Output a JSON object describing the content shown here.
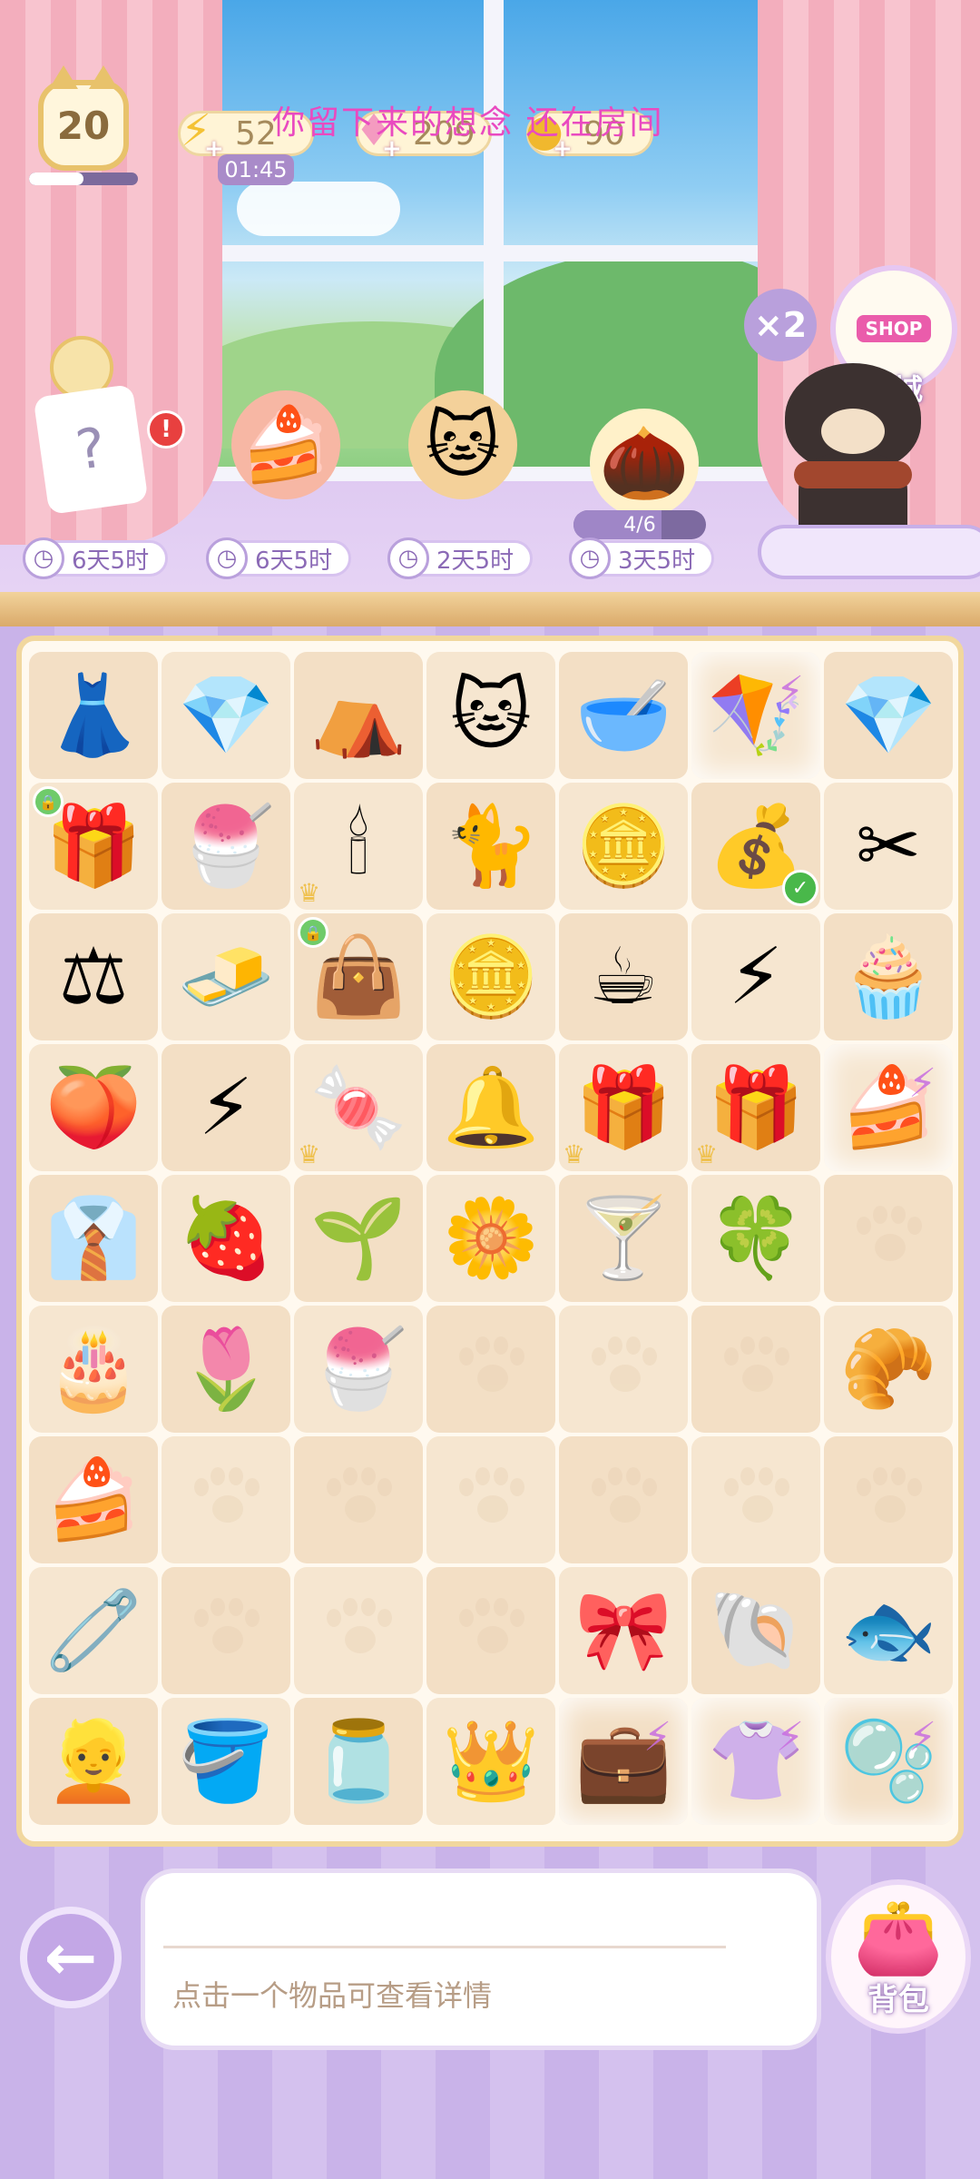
{
  "hud": {
    "level": "20",
    "level_progress": 0.5,
    "energy": "52",
    "energy_timer": "01:45",
    "gems": "209",
    "coins": "90",
    "banner_text": "你留下来的想念 还在房间"
  },
  "shop": {
    "sign": "SHOP",
    "label": "商城",
    "multiplier": "×2"
  },
  "orders": [
    {
      "timer": "6天5时",
      "alert": "!"
    },
    {
      "timer": "6天5时"
    },
    {
      "timer": "2天5时"
    },
    {
      "timer": "3天5时",
      "progress_text": "4/6",
      "progress": 0.6667
    }
  ],
  "board": {
    "rows": [
      [
        {
          "icon": "dress-icon",
          "glyph": "👗"
        },
        {
          "icon": "pink-gems-icon",
          "glyph": "💎"
        },
        {
          "icon": "tent-icon",
          "glyph": "⛺"
        },
        {
          "icon": "brown-cat-icon",
          "glyph": "🐱"
        },
        {
          "icon": "pet-bowl-icon",
          "glyph": "🥣"
        },
        {
          "icon": "swing-energy-icon",
          "glyph": "🪁",
          "bolt": true
        },
        {
          "icon": "pink-gem-icon",
          "glyph": "💎"
        }
      ],
      [
        {
          "icon": "gift-box-icon",
          "glyph": "🎁",
          "lock": true
        },
        {
          "icon": "parfait-icon",
          "glyph": "🍧"
        },
        {
          "icon": "candelabra-icon",
          "glyph": "🕯",
          "crown": true
        },
        {
          "icon": "white-cat-icon",
          "glyph": "🐈"
        },
        {
          "icon": "coin-pile-icon",
          "glyph": "🪙"
        },
        {
          "icon": "coin-sack-icon",
          "glyph": "💰",
          "check": true
        },
        {
          "icon": "pruning-shears-icon",
          "glyph": "✂"
        }
      ],
      [
        {
          "icon": "scale-icon",
          "glyph": "⚖"
        },
        {
          "icon": "butter-cream-icon",
          "glyph": "🧈"
        },
        {
          "icon": "blue-bag-icon",
          "glyph": "👜",
          "lock": true
        },
        {
          "icon": "coins-icon",
          "glyph": "🪙"
        },
        {
          "icon": "coffee-bowl-icon",
          "glyph": "☕"
        },
        {
          "icon": "energy-stack-icon",
          "glyph": "⚡"
        },
        {
          "icon": "cupcake-icon",
          "glyph": "🧁"
        }
      ],
      [
        {
          "icon": "peach-icon",
          "glyph": "🍑"
        },
        {
          "icon": "double-energy-icon",
          "glyph": "⚡"
        },
        {
          "icon": "snack-pack-icon",
          "glyph": "🍬",
          "crown": true
        },
        {
          "icon": "bells-icon",
          "glyph": "🔔"
        },
        {
          "icon": "blue-gift-icon",
          "glyph": "🎁",
          "crown": true
        },
        {
          "icon": "blue-gift-icon",
          "glyph": "🎁",
          "crown": true
        },
        {
          "icon": "dessert-box-icon",
          "glyph": "🍰",
          "bolt": true
        }
      ],
      [
        {
          "icon": "outfit-icon",
          "glyph": "👔"
        },
        {
          "icon": "strawberry-basket-icon",
          "glyph": "🍓"
        },
        {
          "icon": "sprout-icon",
          "glyph": "🌱"
        },
        {
          "icon": "lily-of-valley-icon",
          "glyph": "🌼"
        },
        {
          "icon": "wine-glass-icon",
          "glyph": "🍸"
        },
        {
          "icon": "clover-icon",
          "glyph": "🍀"
        },
        {
          "icon": "empty"
        }
      ],
      [
        {
          "icon": "fruit-cake-icon",
          "glyph": "🎂"
        },
        {
          "icon": "tulip-icon",
          "glyph": "🌷"
        },
        {
          "icon": "parfait-icon",
          "glyph": "🍧"
        },
        {
          "icon": "empty"
        },
        {
          "icon": "empty"
        },
        {
          "icon": "empty"
        },
        {
          "icon": "cream-puff-icon",
          "glyph": "🥐"
        }
      ],
      [
        {
          "icon": "cake-slice-icon",
          "glyph": "🍰"
        },
        {
          "icon": "empty"
        },
        {
          "icon": "empty"
        },
        {
          "icon": "empty"
        },
        {
          "icon": "empty"
        },
        {
          "icon": "empty"
        },
        {
          "icon": "empty"
        }
      ],
      [
        {
          "icon": "hanger-icon",
          "glyph": "🧷"
        },
        {
          "icon": "empty"
        },
        {
          "icon": "empty"
        },
        {
          "icon": "empty"
        },
        {
          "icon": "wig-icon",
          "glyph": "🎀"
        },
        {
          "icon": "seashell-icon",
          "glyph": "🐚"
        },
        {
          "icon": "fish-icon",
          "glyph": "🐟"
        }
      ],
      [
        {
          "icon": "blonde-wig-icon",
          "glyph": "👱"
        },
        {
          "icon": "watering-can-icon",
          "glyph": "🪣"
        },
        {
          "icon": "berry-jar-icon",
          "glyph": "🫙"
        },
        {
          "icon": "tiara-icon",
          "glyph": "👑"
        },
        {
          "icon": "jewelry-box-icon",
          "glyph": "💼",
          "bolt": true
        },
        {
          "icon": "clothes-rack-icon",
          "glyph": "👚",
          "bolt": true
        },
        {
          "icon": "fishbowl-icon",
          "glyph": "🫧",
          "bolt": true
        }
      ]
    ]
  },
  "bottom": {
    "back_icon": "back-arrow-icon",
    "hint": "点击一个物品可查看详情",
    "bag_label": "背包"
  },
  "colors": {
    "accent_pink": "#e94ac0",
    "board_border": "#f1d79e",
    "lavender": "#c8b2e6"
  }
}
